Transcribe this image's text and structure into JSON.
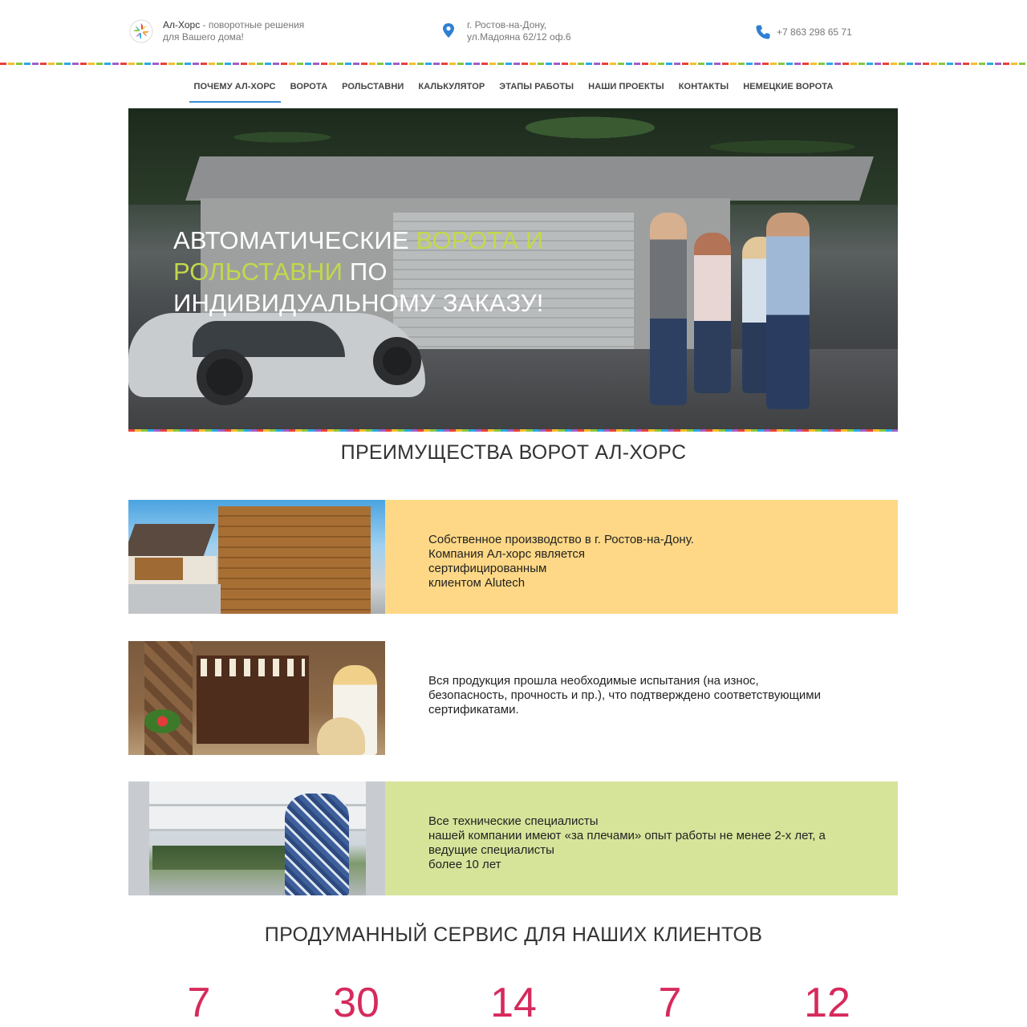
{
  "header": {
    "brand_name": "Ал-Хорс",
    "brand_tagline": " - поворотные решения для Вашего дома!",
    "address_line1": "г. Ростов-на-Дону,",
    "address_line2": "ул.Мадояна 62/12 оф.6",
    "phone": "+7 863 298 65 71"
  },
  "nav": {
    "items": [
      {
        "label": "ПОЧЕМУ АЛ-ХОРС",
        "active": true
      },
      {
        "label": "ВОРОТА"
      },
      {
        "label": "РОЛЬСТАВНИ"
      },
      {
        "label": "КАЛЬКУЛЯТОР"
      },
      {
        "label": "ЭТАПЫ РАБОТЫ"
      },
      {
        "label": "НАШИ ПРОЕКТЫ"
      },
      {
        "label": "КОНТАКТЫ"
      },
      {
        "label": "НЕМЕЦКИЕ ВОРОТА"
      }
    ]
  },
  "hero": {
    "title_part1": "АВТОМАТИЧЕСКИЕ ",
    "title_highlight1": "ВОРОТА И РОЛЬСТАВНИ",
    "title_part2": " ПО ИНДИВИДУАЛЬНОМУ ЗАКАЗУ!"
  },
  "advantages": {
    "title": "ПРЕИМУЩЕСТВА ВОРОТ АЛ-ХОРС",
    "items": [
      {
        "lines": [
          "Собственное производство в г. Ростов-на-Дону.",
          "Компания Ал-хорс является",
          "сертифицированным",
          "клиентом Alutech"
        ],
        "bg": "#fed886"
      },
      {
        "lines": [
          "Вся продукция прошла необходимые испытания (на износ,",
          "безопасность, прочность и пр.), что подтверждено соответствующими",
          "сертификатами."
        ],
        "bg": "#ffffff"
      },
      {
        "lines": [
          "Все технические специалисты",
          "нашей компании имеют «за плечами» опыт работы не менее 2-х лет, а",
          "ведущие специалисты",
          "более 10 лет"
        ],
        "bg": "#d6e49a"
      }
    ]
  },
  "service": {
    "title": "ПРОДУМАННЫЙ СЕРВИС ДЛЯ НАШИХ КЛИЕНТОВ",
    "stats": [
      "7",
      "30",
      "14",
      "7",
      "12"
    ]
  },
  "colors": {
    "accent_blue": "#3b8fd8",
    "hero_highlight": "#c3d84a",
    "stat_pink": "#d62a5c"
  }
}
